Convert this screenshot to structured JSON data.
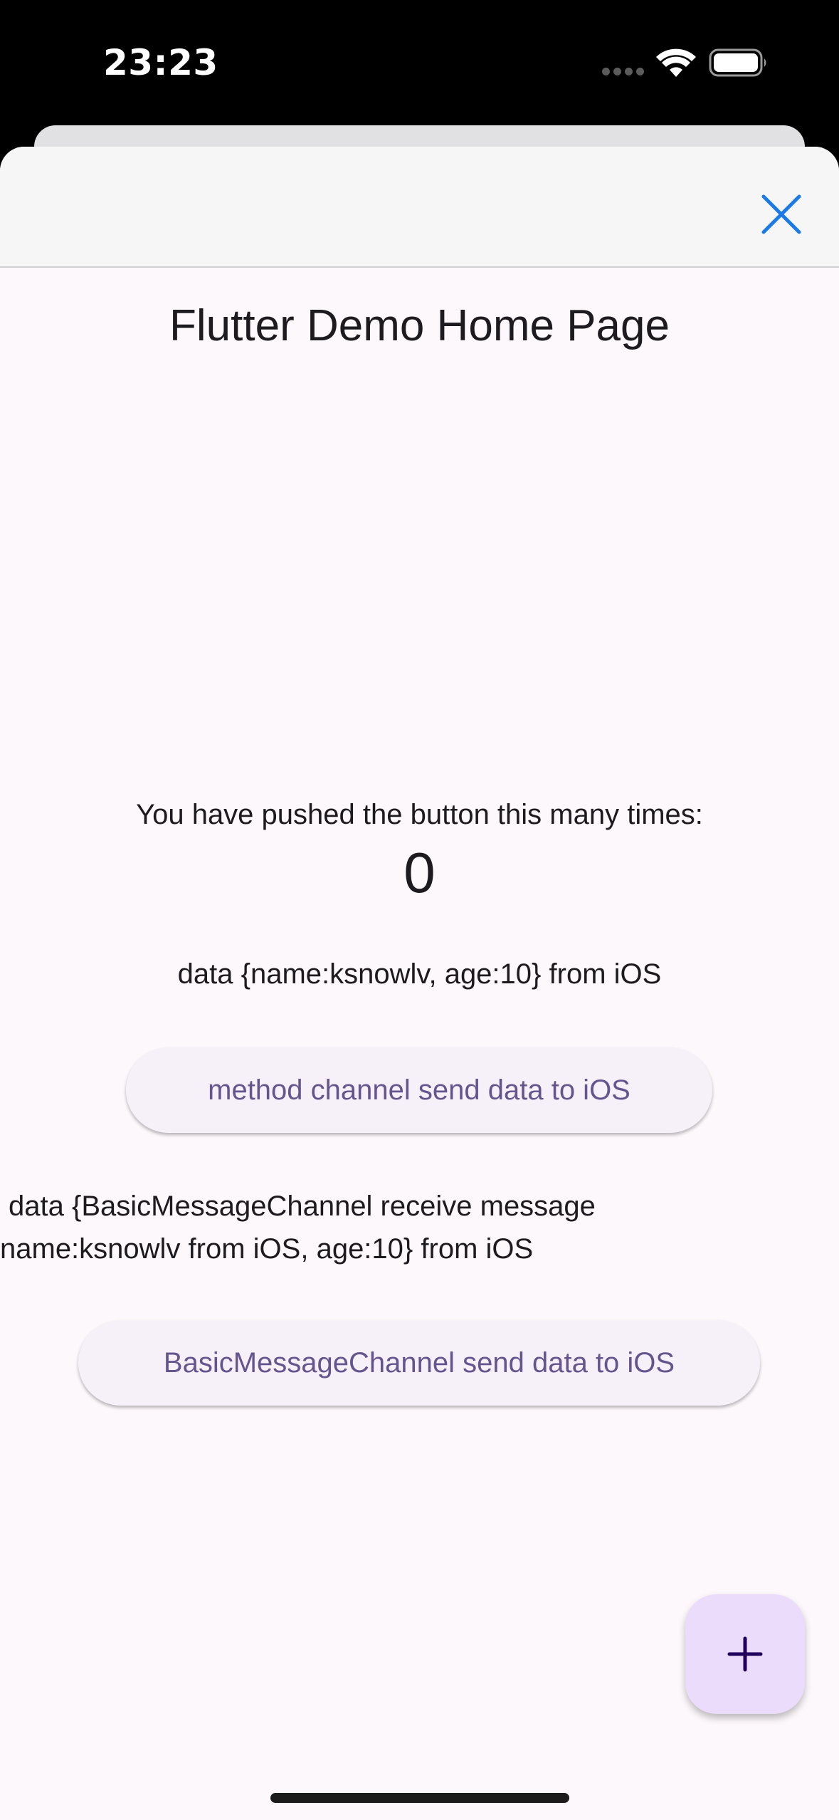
{
  "status_bar": {
    "time": "23:23",
    "icons": [
      "cellular-dots-icon",
      "wifi-icon",
      "battery-icon"
    ]
  },
  "sheet": {
    "close_icon": "close-icon"
  },
  "app_bar": {
    "title": "Flutter Demo Home Page"
  },
  "main": {
    "counter_label": "You have pushed the button this many times:",
    "counter_value": "0",
    "method_channel_data": "data {name:ksnowlv, age:10} from iOS",
    "method_channel_button": "method channel send data to iOS",
    "basic_channel_data_line1": "data {BasicMessageChannel receive message",
    "basic_channel_data_line2": "name:ksnowlv from iOS, age:10} from iOS",
    "basic_channel_button": "BasicMessageChannel send data to iOS"
  },
  "fab": {
    "icon": "plus-icon"
  },
  "colors": {
    "accent": "#1a7be8",
    "button_text": "#65558f",
    "fab_bg": "#eadcfa",
    "surface": "#fdf8fc"
  }
}
